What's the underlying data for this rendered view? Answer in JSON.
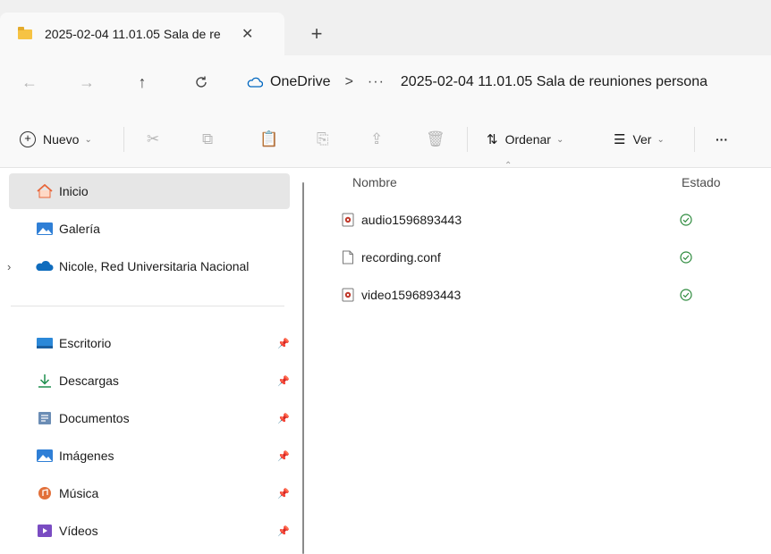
{
  "tab": {
    "title": "2025-02-04 11.01.05 Sala de re",
    "close_glyph": "✕",
    "new_tab_glyph": "+"
  },
  "nav": {
    "back": "←",
    "forward": "→",
    "up": "↑",
    "refresh": "C"
  },
  "address": {
    "root": "OneDrive",
    "separator": ">",
    "ellipsis": "···",
    "current": "2025-02-04 11.01.05 Sala de reuniones persona"
  },
  "commands": {
    "new_label": "Nuevo",
    "sort_label": "Ordenar",
    "view_label": "Ver",
    "more": "···"
  },
  "sidebar": {
    "top": [
      {
        "label": "Inicio"
      },
      {
        "label": "Galería"
      },
      {
        "label": "Nicole, Red Universitaria Nacional"
      }
    ],
    "pinned": [
      {
        "label": "Escritorio"
      },
      {
        "label": "Descargas"
      },
      {
        "label": "Documentos"
      },
      {
        "label": "Imágenes"
      },
      {
        "label": "Música"
      },
      {
        "label": "Vídeos"
      }
    ]
  },
  "columns": {
    "name": "Nombre",
    "status": "Estado"
  },
  "files": [
    {
      "name": "audio1596893443",
      "type": "media"
    },
    {
      "name": "recording.conf",
      "type": "document"
    },
    {
      "name": "video1596893443",
      "type": "media"
    }
  ],
  "colors": {
    "accent": "#0067c0",
    "sync_ok": "#2e8b3e",
    "folder": "#f6c344"
  }
}
